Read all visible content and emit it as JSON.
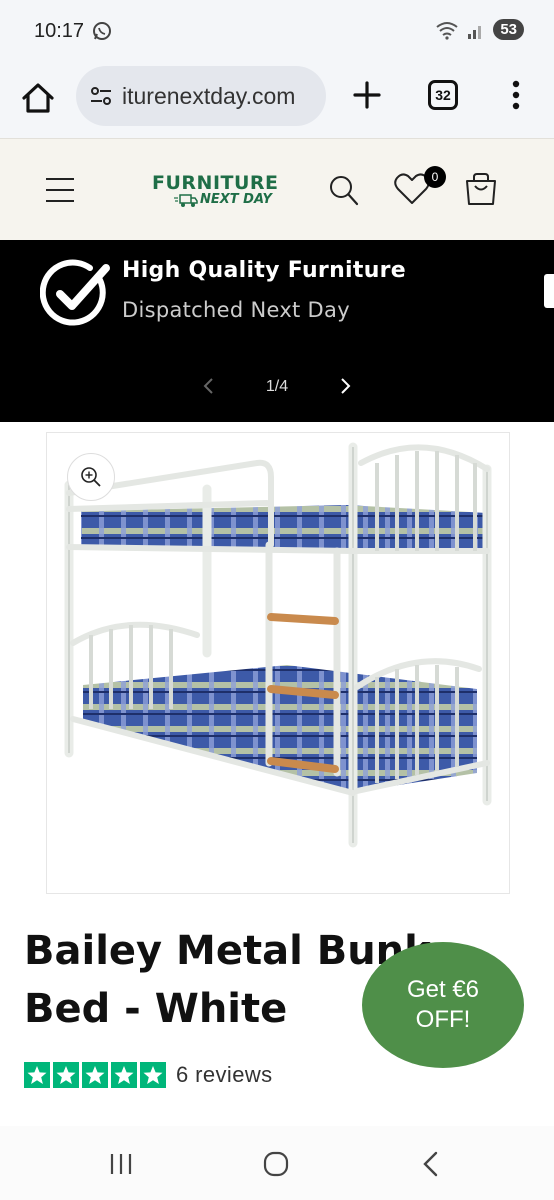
{
  "status_bar": {
    "time": "10:17",
    "battery": "53",
    "whatsapp_icon": "whatsapp-icon",
    "signal_icon": "signal-icon",
    "wifi_icon": "wifi-icon"
  },
  "browser": {
    "url": "iturenextday.com",
    "tab_count": "32",
    "icons": [
      "home-icon",
      "site-settings-icon",
      "plus-icon",
      "tabs-icon",
      "more-vert-icon"
    ]
  },
  "site_header": {
    "logo_top": "FURNITURE",
    "logo_bottom": "NEXT DAY",
    "wishlist_count": "0",
    "brand_color": "#1f6e47"
  },
  "promo_banner": {
    "title": "High Quality Furniture",
    "subtitle": "Dispatched Next Day",
    "slide_counter": "1/4"
  },
  "product": {
    "title": "Bailey Metal Bunk Bed - White",
    "rating": 5,
    "review_count": "6 reviews",
    "star_color": "#00b67a",
    "image_alt": "white metal bunk bed with blue checked mattresses"
  },
  "offer_bubble": {
    "line1": "Get €6",
    "line2": "OFF!",
    "color": "#4f8f49"
  },
  "nav_bar": {
    "icons": [
      "recent-apps-icon",
      "home-circle-icon",
      "back-icon"
    ]
  }
}
